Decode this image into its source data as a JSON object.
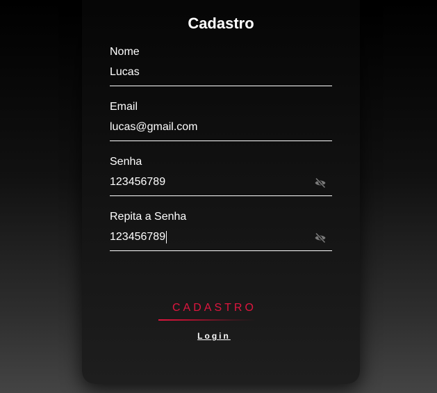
{
  "form": {
    "title": "Cadastro",
    "fields": [
      {
        "label": "Nome",
        "value": "Lucas"
      },
      {
        "label": "Email",
        "value": "lucas@gmail.com"
      },
      {
        "label": "Senha",
        "value": "123456789",
        "visibility_icon": "eye-off-icon"
      },
      {
        "label": "Repita a Senha",
        "value": "123456789",
        "visibility_icon": "eye-off-icon"
      }
    ],
    "submit_label": "CADASTRO",
    "login_link": "Login"
  },
  "colors": {
    "accent": "#e0163f",
    "text": "#ffffff",
    "icon": "#7a7a7a"
  }
}
